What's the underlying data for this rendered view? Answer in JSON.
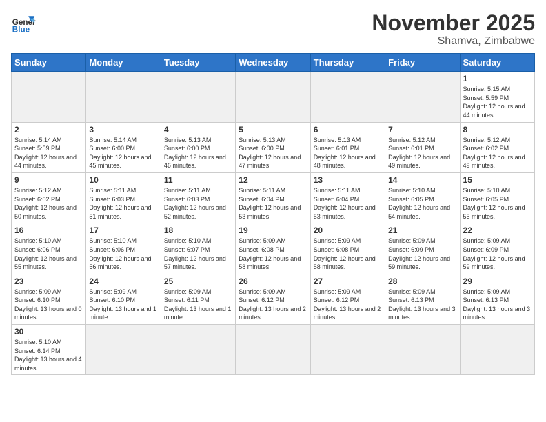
{
  "header": {
    "logo_general": "General",
    "logo_blue": "Blue",
    "month_title": "November 2025",
    "location": "Shamva, Zimbabwe"
  },
  "weekdays": [
    "Sunday",
    "Monday",
    "Tuesday",
    "Wednesday",
    "Thursday",
    "Friday",
    "Saturday"
  ],
  "days": {
    "1": {
      "sunrise": "5:15 AM",
      "sunset": "5:59 PM",
      "daylight": "12 hours and 44 minutes."
    },
    "2": {
      "sunrise": "5:14 AM",
      "sunset": "5:59 PM",
      "daylight": "12 hours and 44 minutes."
    },
    "3": {
      "sunrise": "5:14 AM",
      "sunset": "6:00 PM",
      "daylight": "12 hours and 45 minutes."
    },
    "4": {
      "sunrise": "5:13 AM",
      "sunset": "6:00 PM",
      "daylight": "12 hours and 46 minutes."
    },
    "5": {
      "sunrise": "5:13 AM",
      "sunset": "6:00 PM",
      "daylight": "12 hours and 47 minutes."
    },
    "6": {
      "sunrise": "5:13 AM",
      "sunset": "6:01 PM",
      "daylight": "12 hours and 48 minutes."
    },
    "7": {
      "sunrise": "5:12 AM",
      "sunset": "6:01 PM",
      "daylight": "12 hours and 49 minutes."
    },
    "8": {
      "sunrise": "5:12 AM",
      "sunset": "6:02 PM",
      "daylight": "12 hours and 49 minutes."
    },
    "9": {
      "sunrise": "5:12 AM",
      "sunset": "6:02 PM",
      "daylight": "12 hours and 50 minutes."
    },
    "10": {
      "sunrise": "5:11 AM",
      "sunset": "6:03 PM",
      "daylight": "12 hours and 51 minutes."
    },
    "11": {
      "sunrise": "5:11 AM",
      "sunset": "6:03 PM",
      "daylight": "12 hours and 52 minutes."
    },
    "12": {
      "sunrise": "5:11 AM",
      "sunset": "6:04 PM",
      "daylight": "12 hours and 53 minutes."
    },
    "13": {
      "sunrise": "5:11 AM",
      "sunset": "6:04 PM",
      "daylight": "12 hours and 53 minutes."
    },
    "14": {
      "sunrise": "5:10 AM",
      "sunset": "6:05 PM",
      "daylight": "12 hours and 54 minutes."
    },
    "15": {
      "sunrise": "5:10 AM",
      "sunset": "6:05 PM",
      "daylight": "12 hours and 55 minutes."
    },
    "16": {
      "sunrise": "5:10 AM",
      "sunset": "6:06 PM",
      "daylight": "12 hours and 55 minutes."
    },
    "17": {
      "sunrise": "5:10 AM",
      "sunset": "6:06 PM",
      "daylight": "12 hours and 56 minutes."
    },
    "18": {
      "sunrise": "5:10 AM",
      "sunset": "6:07 PM",
      "daylight": "12 hours and 57 minutes."
    },
    "19": {
      "sunrise": "5:09 AM",
      "sunset": "6:08 PM",
      "daylight": "12 hours and 58 minutes."
    },
    "20": {
      "sunrise": "5:09 AM",
      "sunset": "6:08 PM",
      "daylight": "12 hours and 58 minutes."
    },
    "21": {
      "sunrise": "5:09 AM",
      "sunset": "6:09 PM",
      "daylight": "12 hours and 59 minutes."
    },
    "22": {
      "sunrise": "5:09 AM",
      "sunset": "6:09 PM",
      "daylight": "12 hours and 59 minutes."
    },
    "23": {
      "sunrise": "5:09 AM",
      "sunset": "6:10 PM",
      "daylight": "13 hours and 0 minutes."
    },
    "24": {
      "sunrise": "5:09 AM",
      "sunset": "6:10 PM",
      "daylight": "13 hours and 1 minute."
    },
    "25": {
      "sunrise": "5:09 AM",
      "sunset": "6:11 PM",
      "daylight": "13 hours and 1 minute."
    },
    "26": {
      "sunrise": "5:09 AM",
      "sunset": "6:12 PM",
      "daylight": "13 hours and 2 minutes."
    },
    "27": {
      "sunrise": "5:09 AM",
      "sunset": "6:12 PM",
      "daylight": "13 hours and 2 minutes."
    },
    "28": {
      "sunrise": "5:09 AM",
      "sunset": "6:13 PM",
      "daylight": "13 hours and 3 minutes."
    },
    "29": {
      "sunrise": "5:09 AM",
      "sunset": "6:13 PM",
      "daylight": "13 hours and 3 minutes."
    },
    "30": {
      "sunrise": "5:10 AM",
      "sunset": "6:14 PM",
      "daylight": "13 hours and 4 minutes."
    }
  }
}
